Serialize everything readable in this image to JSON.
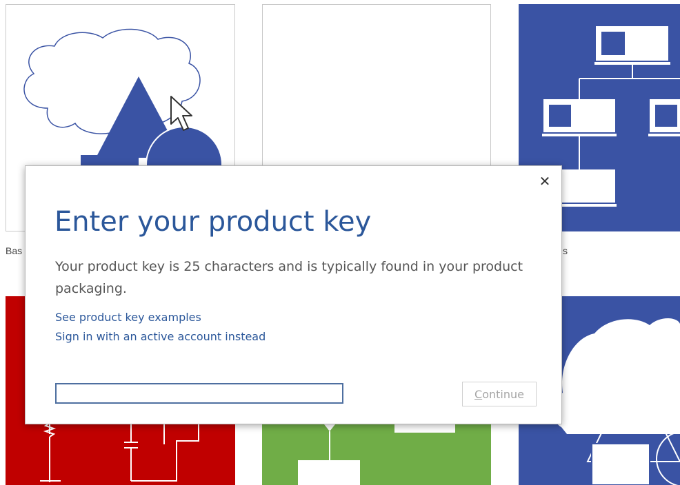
{
  "background_tiles": {
    "basic_diagram_label": "Bas",
    "org_chart_label_fragment": "s"
  },
  "dialog": {
    "title": "Enter your product key",
    "description": "Your product key is 25 characters and is typically found in your product packaging.",
    "links": {
      "examples": "See product key examples",
      "sign_in": "Sign in with an active account instead"
    },
    "key_input": {
      "value": "",
      "placeholder": ""
    },
    "continue_button": {
      "mnemonic": "C",
      "rest": "ontinue",
      "enabled": false
    },
    "close_glyph": "✕"
  },
  "colors": {
    "accent_blue": "#2b579a",
    "shape_blue": "#3a53a4",
    "tile_red": "#c00000",
    "tile_green": "#70ad47"
  }
}
